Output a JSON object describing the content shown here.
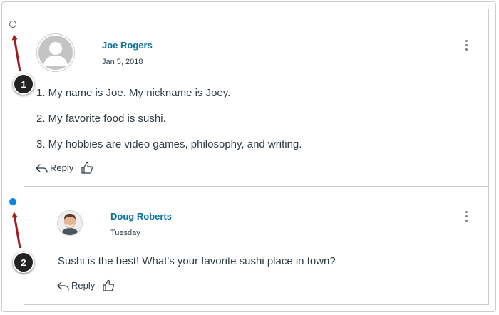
{
  "thread": {
    "entry": {
      "author": "Joe Rogers",
      "date": "Jan 5, 2018",
      "lines": [
        "1. My name is Joe. My nickname is Joey.",
        "2. My favorite food is sushi.",
        "3. My hobbies are video games, philosophy, and writing."
      ],
      "reply_label": "Reply",
      "status": "read"
    },
    "reply": {
      "author": "Doug Roberts",
      "date": "Tuesday",
      "text": "Sushi is the best! What's your favorite sushi place in town?",
      "reply_label": "Reply",
      "status": "unread"
    }
  },
  "callouts": [
    "1",
    "2"
  ],
  "colors": {
    "author_link": "#0770a3",
    "unread_dot": "#0a84e6",
    "arrow": "#9e1c20",
    "border": "#c7cdd1"
  },
  "icons": [
    "options-kebab-icon",
    "reply-arrow-icon",
    "thumbs-up-icon",
    "avatar-placeholder-icon"
  ]
}
